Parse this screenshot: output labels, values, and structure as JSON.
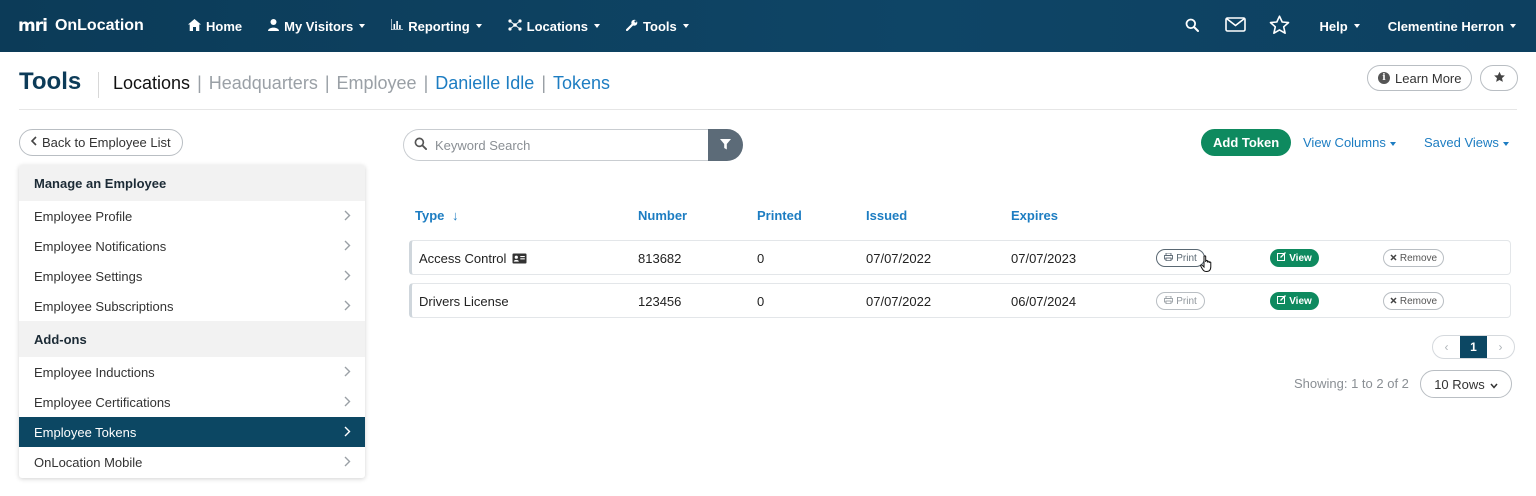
{
  "app": {
    "logo_text": "mri",
    "brand_name": "OnLocation"
  },
  "nav": {
    "items": [
      {
        "label": "Home",
        "icon": "home-icon"
      },
      {
        "label": "My Visitors",
        "icon": "user-icon"
      },
      {
        "label": "Reporting",
        "icon": "bar-chart-icon"
      },
      {
        "label": "Locations",
        "icon": "network-icon"
      },
      {
        "label": "Tools",
        "icon": "wrench-icon"
      }
    ],
    "help_label": "Help",
    "user_name": "Clementine Herron"
  },
  "header": {
    "title": "Tools",
    "breadcrumb": {
      "current": "Locations",
      "items": [
        "Headquarters",
        "Employee",
        "Danielle Idle",
        "Tokens"
      ],
      "sep": "|"
    },
    "learn_more_label": "Learn More"
  },
  "sidebar": {
    "back_label": "Back to Employee List",
    "section1": "Manage an Employee",
    "manage_items": [
      "Employee Profile",
      "Employee Notifications",
      "Employee Settings",
      "Employee Subscriptions"
    ],
    "section2": "Add-ons",
    "addon_items": [
      "Employee Inductions",
      "Employee Certifications",
      "Employee Tokens",
      "OnLocation Mobile"
    ],
    "active_item": "Employee Tokens"
  },
  "toolbar": {
    "search_placeholder": "Keyword Search",
    "add_label": "Add Token",
    "view_columns_label": "View Columns",
    "saved_views_label": "Saved Views"
  },
  "table": {
    "columns": [
      "Type",
      "Number",
      "Printed",
      "Issued",
      "Expires"
    ],
    "sort_indicator": "↓",
    "rows": [
      {
        "type": "Access Control",
        "number": "813682",
        "printed": "0",
        "issued": "07/07/2022",
        "expires": "07/07/2023"
      },
      {
        "type": "Drivers License",
        "number": "123456",
        "printed": "0",
        "issued": "07/07/2022",
        "expires": "06/07/2024"
      }
    ],
    "print_label": "Print",
    "view_label": "View",
    "remove_label": "Remove"
  },
  "pagination": {
    "prev": "‹",
    "current_page": "1",
    "next": "›",
    "showing": "Showing: 1 to 2 of 2",
    "rows_label": "10 Rows"
  },
  "colors": {
    "nav_bg": "#0c3b58",
    "accent_blue": "#1d7dc2",
    "green": "#0e8a5f",
    "active_bg": "#0c4763"
  }
}
